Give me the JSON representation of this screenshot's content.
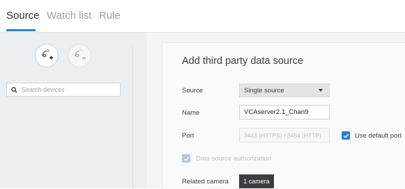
{
  "tabs": [
    {
      "label": "Source",
      "active": true
    },
    {
      "label": "Watch list",
      "active": false
    },
    {
      "label": "Rule",
      "active": false
    }
  ],
  "sidebar": {
    "buttons": [
      {
        "icon": "add-source-icon",
        "enabled": true
      },
      {
        "icon": "remove-source-icon",
        "enabled": false
      }
    ],
    "search": {
      "placeholder": "Search devices",
      "value": "",
      "icon": "search-icon"
    }
  },
  "form": {
    "title": "Add third party data source",
    "source": {
      "label": "Source",
      "value": "Single source"
    },
    "name": {
      "label": "Name",
      "value": "VCAserver2.1_Chan9"
    },
    "port": {
      "label": "Port",
      "value": "3443 (HTTPS) / 3454 (HTTP)",
      "use_default_label": "Use default port",
      "use_default_checked": true
    },
    "auth": {
      "label": "Data source authorization",
      "checked": true,
      "enabled": false
    },
    "related_camera": {
      "label": "Related camera",
      "button_label": "1 camera"
    }
  },
  "colors": {
    "accent": "#2a7dd8",
    "sidebar_bg": "#eceff2",
    "dark_button": "#3a3d42"
  }
}
